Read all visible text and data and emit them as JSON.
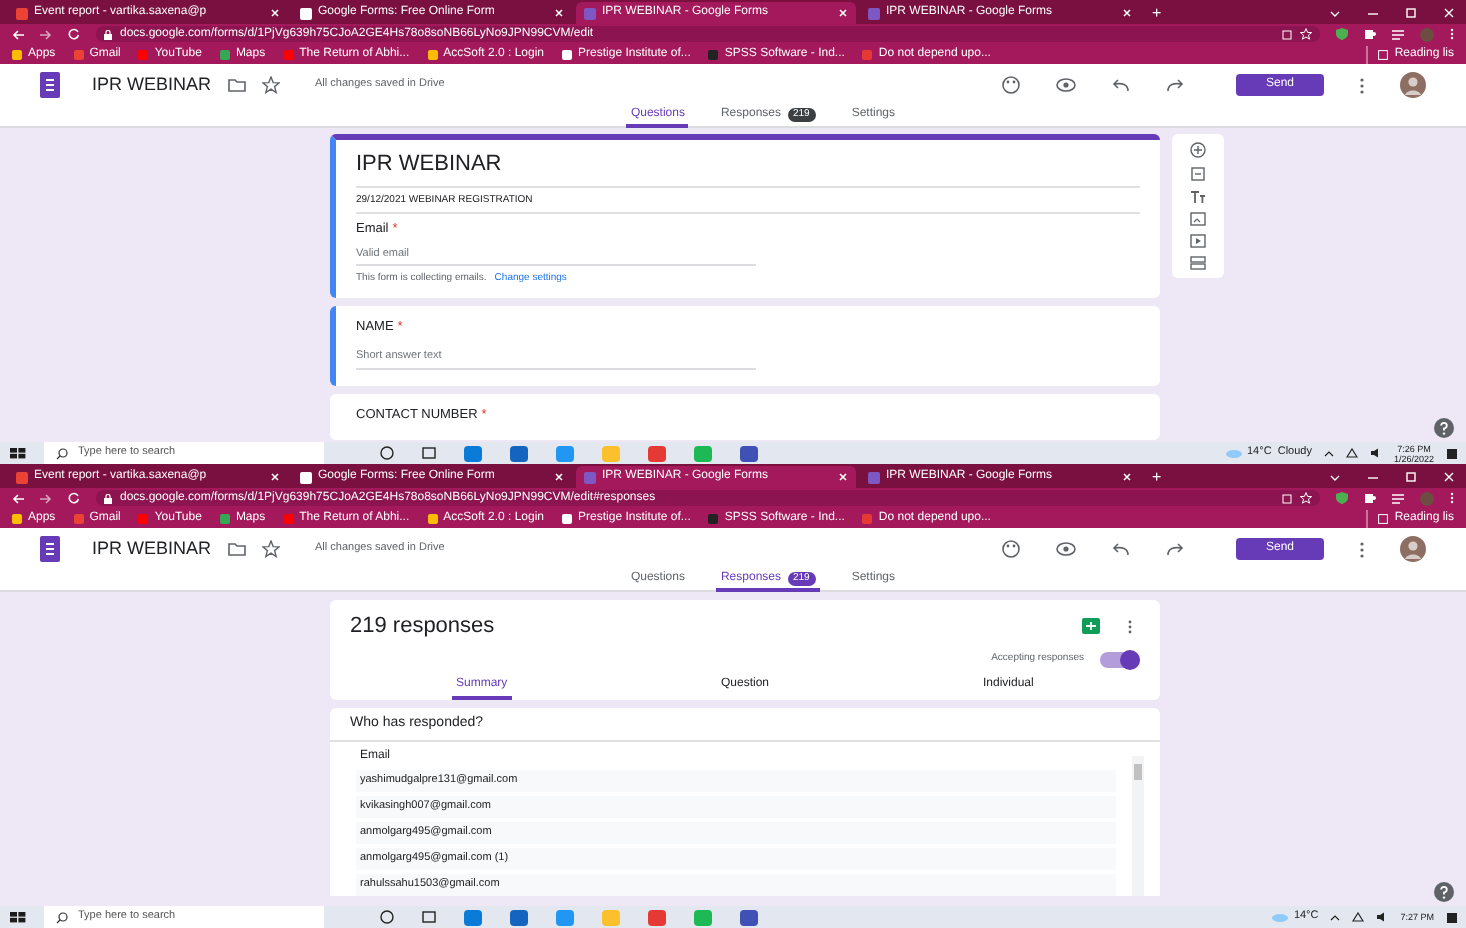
{
  "screens": [
    {
      "browser": {
        "tabs": [
          {
            "label": "Event report - vartika.saxena@p",
            "selected": false
          },
          {
            "label": "Google Forms: Free Online Form",
            "selected": false
          },
          {
            "label": "IPR WEBINAR - Google Forms",
            "selected": true
          },
          {
            "label": "IPR WEBINAR - Google Forms",
            "selected": false
          }
        ],
        "new_tab": "+",
        "address": "docs.google.com/forms/d/1PjVg639h75CJoA2GE4Hs78o8soNB66LyNo9JPN99CVM/edit",
        "bookmarks": [
          "Apps",
          "Gmail",
          "YouTube",
          "Maps",
          "The Return of Abhi...",
          "AccSoft 2.0 : Login",
          "Prestige Institute of...",
          "SPSS Software - Ind...",
          "Do not depend upo..."
        ],
        "reading_list": "Reading lis"
      },
      "app": {
        "title": "IPR WEBINAR",
        "status": "All changes saved in Drive",
        "send": "Send",
        "tabs": [
          {
            "label": "Questions",
            "selected": true
          },
          {
            "label": "Responses",
            "badge": "219",
            "selected": false
          },
          {
            "label": "Settings",
            "selected": false
          }
        ]
      },
      "content": {
        "kind": "questions",
        "header": {
          "title": "IPR WEBINAR",
          "description": "29/12/2021 WEBINAR REGISTRATION",
          "email_label": "Email",
          "mark": "*",
          "placeholder": "Valid email",
          "note": "This form is collecting emails.",
          "link": "Change settings"
        },
        "questions": [
          {
            "title": "NAME",
            "mark": "*",
            "placeholder": "Short answer text",
            "active": true
          },
          {
            "title": "CONTACT NUMBER",
            "mark": "*",
            "active": false
          }
        ]
      },
      "taskbar": {
        "search": "Type here to search",
        "weather": "14°C  Cloudy",
        "time": "7:26 PM",
        "date": "1/26/2022"
      }
    },
    {
      "browser": {
        "tabs": [
          {
            "label": "Event report - vartika.saxena@p",
            "selected": false
          },
          {
            "label": "Google Forms: Free Online Form",
            "selected": false
          },
          {
            "label": "IPR WEBINAR - Google Forms",
            "selected": true
          },
          {
            "label": "IPR WEBINAR - Google Forms",
            "selected": false
          }
        ],
        "new_tab": "+",
        "address": "docs.google.com/forms/d/1PjVg639h75CJoA2GE4Hs78o8soNB66LyNo9JPN99CVM/edit#responses",
        "bookmarks": [
          "Apps",
          "Gmail",
          "YouTube",
          "Maps",
          "The Return of Abhi...",
          "AccSoft 2.0 : Login",
          "Prestige Institute of...",
          "SPSS Software - Ind...",
          "Do not depend upo..."
        ],
        "reading_list": "Reading lis"
      },
      "app": {
        "title": "IPR WEBINAR",
        "status": "All changes saved in Drive",
        "send": "Send",
        "tabs": [
          {
            "label": "Questions",
            "selected": false
          },
          {
            "label": "Responses",
            "badge": "219",
            "selected": true
          },
          {
            "label": "Settings",
            "selected": false
          }
        ]
      },
      "content": {
        "kind": "responses",
        "count": "219 responses",
        "accepting_label": "Accepting responses",
        "accepting": true,
        "subtabs": [
          {
            "label": "Summary",
            "selected": true
          },
          {
            "label": "Question",
            "selected": false
          },
          {
            "label": "Individual",
            "selected": false
          }
        ],
        "section_title": "Who has responded?",
        "column": "Email",
        "rows": [
          "yashimudgalpre131@gmail.com",
          "kvikasingh007@gmail.com",
          "anmolgarg495@gmail.com",
          "anmolgarg495@gmail.com (1)",
          "rahulssahu1503@gmail.com"
        ]
      },
      "taskbar": {
        "search": "Type here to search",
        "weather": "14°C",
        "time": "7:27 PM"
      }
    }
  ]
}
